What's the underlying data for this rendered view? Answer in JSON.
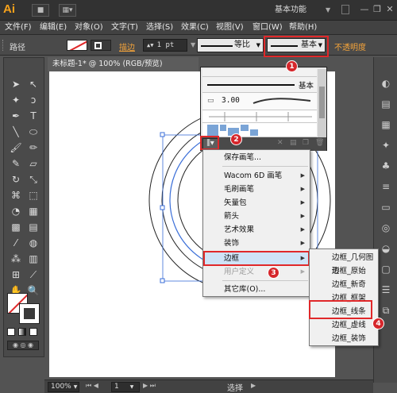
{
  "app": {
    "logo": "Ai",
    "workspace": "基本功能",
    "window_buttons": [
      "minimize-icon",
      "restore-icon",
      "close-icon"
    ]
  },
  "menubar": {
    "items": [
      "文件(F)",
      "编辑(E)",
      "对象(O)",
      "文字(T)",
      "选择(S)",
      "效果(C)",
      "视图(V)",
      "窗口(W)",
      "帮助(H)"
    ]
  },
  "control": {
    "label": "路径",
    "stroke_label": "描边",
    "stroke_weight": "1 pt",
    "profile_label": "等比",
    "brush_label": "基本",
    "opacity_label": "不透明度"
  },
  "document": {
    "tab_title": "未标题-1* @ 100% (RGB/预览)"
  },
  "brush_panel": {
    "rows": [
      {
        "label": ""
      },
      {
        "label": "基本"
      },
      {
        "label": "3.00"
      },
      {
        "label": ""
      }
    ]
  },
  "lib_menu": {
    "items": [
      {
        "label": "保存画笔...",
        "submenu": false,
        "enabled": true
      },
      {
        "label": "Wacom 6D 画笔",
        "submenu": true,
        "enabled": true
      },
      {
        "label": "毛刷画笔",
        "submenu": true,
        "enabled": true
      },
      {
        "label": "矢量包",
        "submenu": true,
        "enabled": true
      },
      {
        "label": "箭头",
        "submenu": true,
        "enabled": true
      },
      {
        "label": "艺术效果",
        "submenu": true,
        "enabled": true
      },
      {
        "label": "装饰",
        "submenu": true,
        "enabled": true
      },
      {
        "label": "边框",
        "submenu": true,
        "enabled": true,
        "highlighted": true
      },
      {
        "label": "用户定义",
        "submenu": true,
        "enabled": false
      },
      {
        "label": "其它库(O)...",
        "submenu": false,
        "enabled": true
      }
    ]
  },
  "sub_menu": {
    "items": [
      "边框_几何图形",
      "边框_原始",
      "边框_新奇",
      "边框_框架",
      "边框_线条",
      "边框_虚线",
      "边框_装饰"
    ],
    "highlighted_index": 4
  },
  "status": {
    "zoom": "100%",
    "page": "1",
    "tool": "选择"
  },
  "badges": [
    "1",
    "2",
    "3",
    "4"
  ],
  "colors": {
    "accent_red": "#e0282a",
    "badge_red": "#d6262b",
    "label_orange": "#f3a33a",
    "selection_blue": "#3a6ed8"
  }
}
